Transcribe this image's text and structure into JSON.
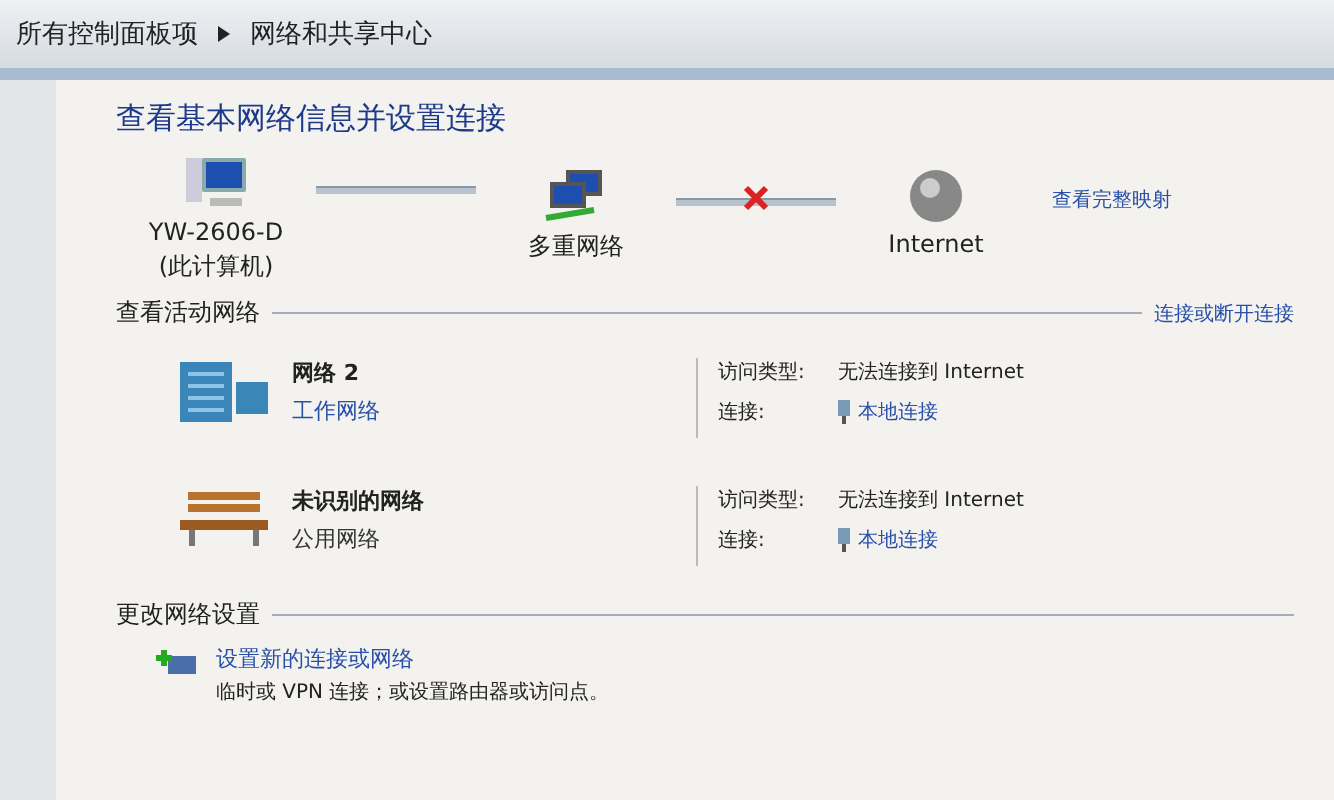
{
  "breadcrumb": [
    {
      "label": "所有控制面板项"
    },
    {
      "label": "网络和共享中心"
    }
  ],
  "heading": "查看基本网络信息并设置连接",
  "map": {
    "nodes": [
      {
        "kind": "computer",
        "label": "YW-2606-D",
        "sublabel": "(此计算机)"
      },
      {
        "kind": "network",
        "label": "多重网络"
      },
      {
        "kind": "internet",
        "label": "Internet"
      }
    ],
    "links": [
      {
        "broken": false
      },
      {
        "broken": true
      }
    ],
    "full_map_link": "查看完整映射"
  },
  "active_section": {
    "title": "查看活动网络",
    "action_link": "连接或断开连接"
  },
  "networks": [
    {
      "kind": "work",
      "name": "网络  2",
      "type": "工作网络",
      "type_is_link": true,
      "access_label": "访问类型:",
      "access_value": "无法连接到 Internet",
      "connection_label": "连接:",
      "connection_value": "本地连接"
    },
    {
      "kind": "public",
      "name": "未识别的网络",
      "type": "公用网络",
      "type_is_link": false,
      "access_label": "访问类型:",
      "access_value": "无法连接到 Internet",
      "connection_label": "连接:",
      "connection_value": "本地连接"
    }
  ],
  "settings_section": {
    "title": "更改网络设置",
    "items": [
      {
        "link": "设置新的连接或网络",
        "description": "临时或 VPN 连接；或设置路由器或访问点。"
      }
    ]
  }
}
